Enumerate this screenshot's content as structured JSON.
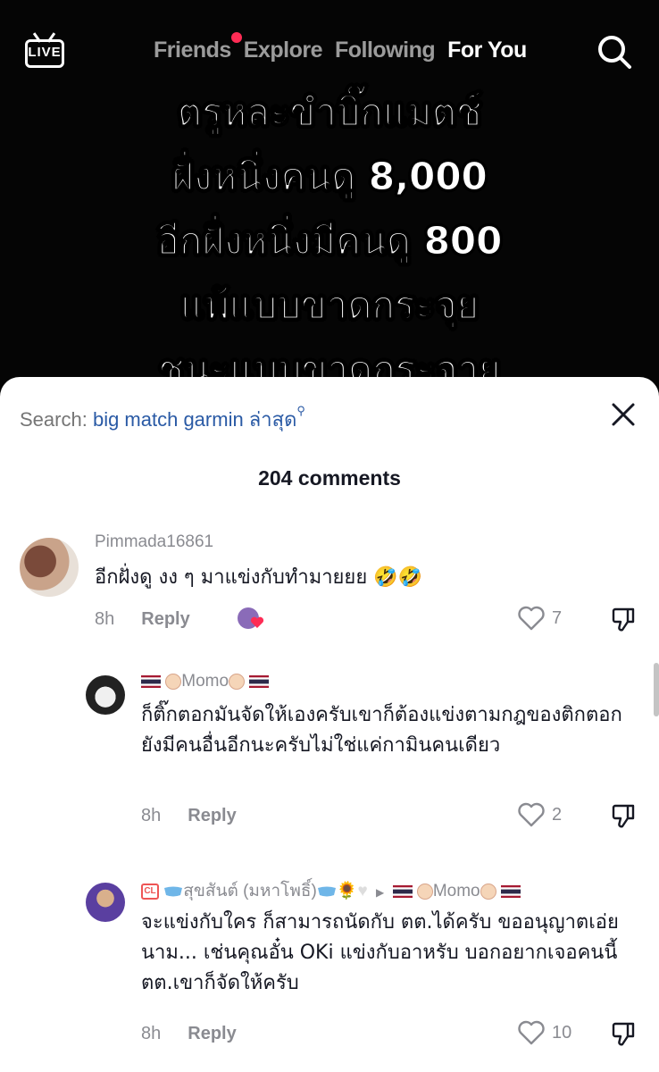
{
  "header": {
    "live_label": "LIVE",
    "tabs": [
      {
        "label": "Friends",
        "active": false,
        "has_dot": true
      },
      {
        "label": "Explore",
        "active": false
      },
      {
        "label": "Following",
        "active": false
      },
      {
        "label": "For You",
        "active": true
      }
    ]
  },
  "video_overlay": {
    "lines": [
      "ตรูหละขำบิ๊กแมตช์",
      "ฝั่งหนึ่งคนดู 8,000",
      "อีกฝั่งหนึ่งมีคนดู 800",
      "แพ้แบบขาดกระจุย",
      "ชนะแบบขาดกระจาย"
    ]
  },
  "comments_sheet": {
    "search_label": "Search:",
    "search_term": "big match garmin ล่าสุด",
    "comment_count": "204 comments",
    "comments": [
      {
        "username": "Pimmada16861",
        "text": "อีกฝั่งดู งง ๆ มาแข่งกับทำมายยย 🤣🤣",
        "time": "8h",
        "reply_label": "Reply",
        "likes": "7"
      },
      {
        "username": "Momo",
        "text": "ก็ติ๊กตอกมันจัดให้เองครับเขาก็ต้องแข่งตามกฎของติกตอกยังมีคนอื่นอีกนะครับไม่ใช่แค่กามินคนเดียว",
        "time": "8h",
        "reply_label": "Reply",
        "likes": "2"
      },
      {
        "username": "สุขสันต์ (มหาโพธิ์)",
        "reply_to": "Momo",
        "text": "จะแข่งกับใคร ก็สามารถนัดกับ ตต.ได้ครับ ขออนุญาตเอ่ยนาม... เช่นคุณอั๋น OKi แข่งกับอาหรับ บอกอยากเจอคนนี้ ตต.เขาก็จัดให้ครับ",
        "time": "8h",
        "reply_label": "Reply",
        "likes": "10"
      }
    ]
  },
  "colors": {
    "accent_red": "#fe2c55",
    "link_blue": "#2a5aa5",
    "muted_gray": "#8a8b91"
  }
}
